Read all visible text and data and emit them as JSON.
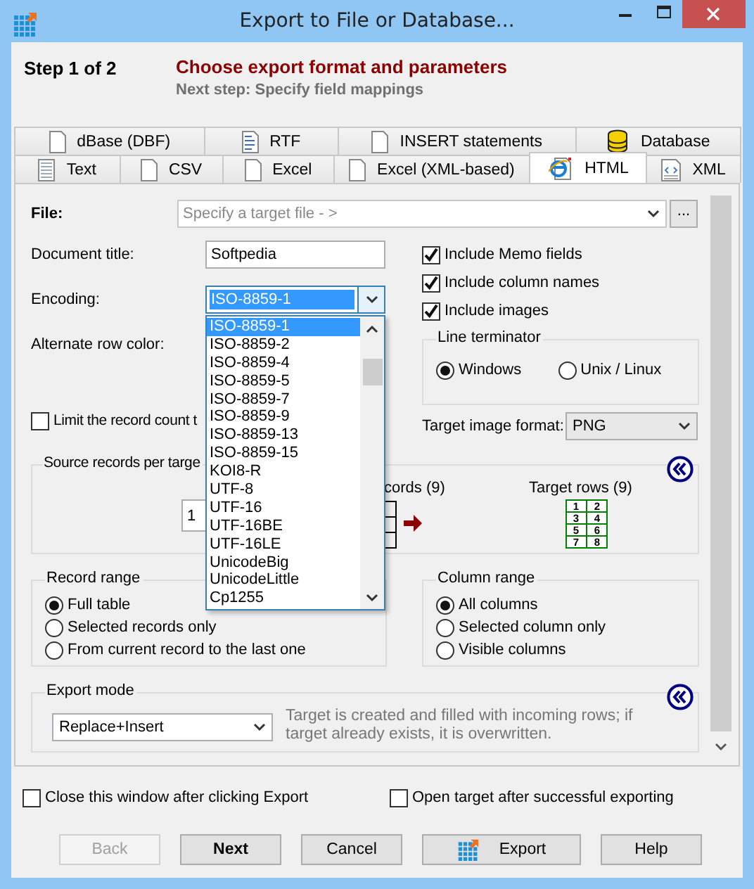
{
  "window": {
    "title": "Export to File or Database..."
  },
  "header": {
    "step": "Step 1 of 2",
    "title": "Choose export format and parameters",
    "next_step": "Next step: Specify field mappings"
  },
  "tab_rows": [
    [
      {
        "label": "dBase (DBF)",
        "kind": "page",
        "selected": false
      },
      {
        "label": "RTF",
        "kind": "document",
        "selected": false
      },
      {
        "label": "INSERT statements",
        "kind": "page",
        "selected": false
      },
      {
        "label": "Database",
        "kind": "database",
        "selected": false
      }
    ],
    [
      {
        "label": "Text",
        "kind": "lines",
        "selected": false
      },
      {
        "label": "CSV",
        "kind": "page",
        "selected": false
      },
      {
        "label": "Excel",
        "kind": "page",
        "selected": false
      },
      {
        "label": "Excel (XML-based)",
        "kind": "page",
        "selected": false
      },
      {
        "label": "HTML",
        "kind": "web",
        "selected": true
      },
      {
        "label": "XML",
        "kind": "markup",
        "selected": false
      }
    ]
  ],
  "file": {
    "label": "File:",
    "placeholder": "Specify a target file - >",
    "browse": "..."
  },
  "document_title": {
    "label": "Document title:",
    "value": "Softpedia"
  },
  "encoding": {
    "label": "Encoding:",
    "value": "ISO-8859-1",
    "list": [
      {
        "label": "ISO-8859-1",
        "selected": true
      },
      {
        "label": "ISO-8859-2",
        "selected": false
      },
      {
        "label": "ISO-8859-4",
        "selected": false
      },
      {
        "label": "ISO-8859-5",
        "selected": false
      },
      {
        "label": "ISO-8859-7",
        "selected": false
      },
      {
        "label": "ISO-8859-9",
        "selected": false
      },
      {
        "label": "ISO-8859-13",
        "selected": false
      },
      {
        "label": "ISO-8859-15",
        "selected": false
      },
      {
        "label": "KOI8-R",
        "selected": false
      },
      {
        "label": "UTF-8",
        "selected": false
      },
      {
        "label": "UTF-16",
        "selected": false
      },
      {
        "label": "UTF-16BE",
        "selected": false
      },
      {
        "label": "UTF-16LE",
        "selected": false
      },
      {
        "label": "UnicodeBig",
        "selected": false
      },
      {
        "label": "UnicodeLittle",
        "selected": false
      },
      {
        "label": "Cp1255",
        "selected": false
      }
    ]
  },
  "alternate_row_color": {
    "label": "Alternate row color:"
  },
  "limit_records": {
    "label": "Limit the record count t",
    "checked": false
  },
  "include_options": [
    {
      "label": "Include Memo fields",
      "checked": true
    },
    {
      "label": "Include column names",
      "checked": true
    },
    {
      "label": "Include images",
      "checked": true
    }
  ],
  "line_terminator": {
    "legend": "Line terminator",
    "options": [
      {
        "label": "Windows",
        "selected": true
      },
      {
        "label": "Unix / Linux",
        "selected": false
      }
    ]
  },
  "target_image_format": {
    "label": "Target image format:",
    "value": "PNG"
  },
  "records_per_target": {
    "legend": "Source records per targe",
    "value": "1",
    "source_label": "cords (9)",
    "target_label": "Target rows (9)",
    "target_cells": [
      "1",
      "2",
      "3",
      "4",
      "5",
      "6",
      "7",
      "8"
    ]
  },
  "record_range": {
    "legend": "Record range",
    "options": [
      {
        "label": "Full table",
        "selected": true
      },
      {
        "label": "Selected records only",
        "selected": false
      },
      {
        "label": "From current record to the last one",
        "selected": false
      }
    ]
  },
  "column_range": {
    "legend": "Column range",
    "options": [
      {
        "label": "All columns",
        "selected": true
      },
      {
        "label": "Selected column only",
        "selected": false
      },
      {
        "label": "Visible columns",
        "selected": false
      }
    ]
  },
  "export_mode": {
    "legend": "Export mode",
    "value": "Replace+Insert",
    "description": "Target is created and filled with incoming rows; if target already exists, it is overwritten."
  },
  "footer_options": [
    {
      "label": "Close this window after clicking Export",
      "checked": false
    },
    {
      "label": "Open target after successful exporting",
      "checked": false
    }
  ],
  "buttons": [
    {
      "label": "Back",
      "kind": "plain",
      "disabled": true,
      "default": false
    },
    {
      "label": "Next",
      "kind": "plain",
      "disabled": false,
      "default": true
    },
    {
      "label": "Cancel",
      "kind": "plain",
      "disabled": false,
      "default": false
    },
    {
      "label": "Export",
      "kind": "export",
      "disabled": false,
      "default": false
    },
    {
      "label": "Help",
      "kind": "plain",
      "disabled": false,
      "default": false
    }
  ]
}
